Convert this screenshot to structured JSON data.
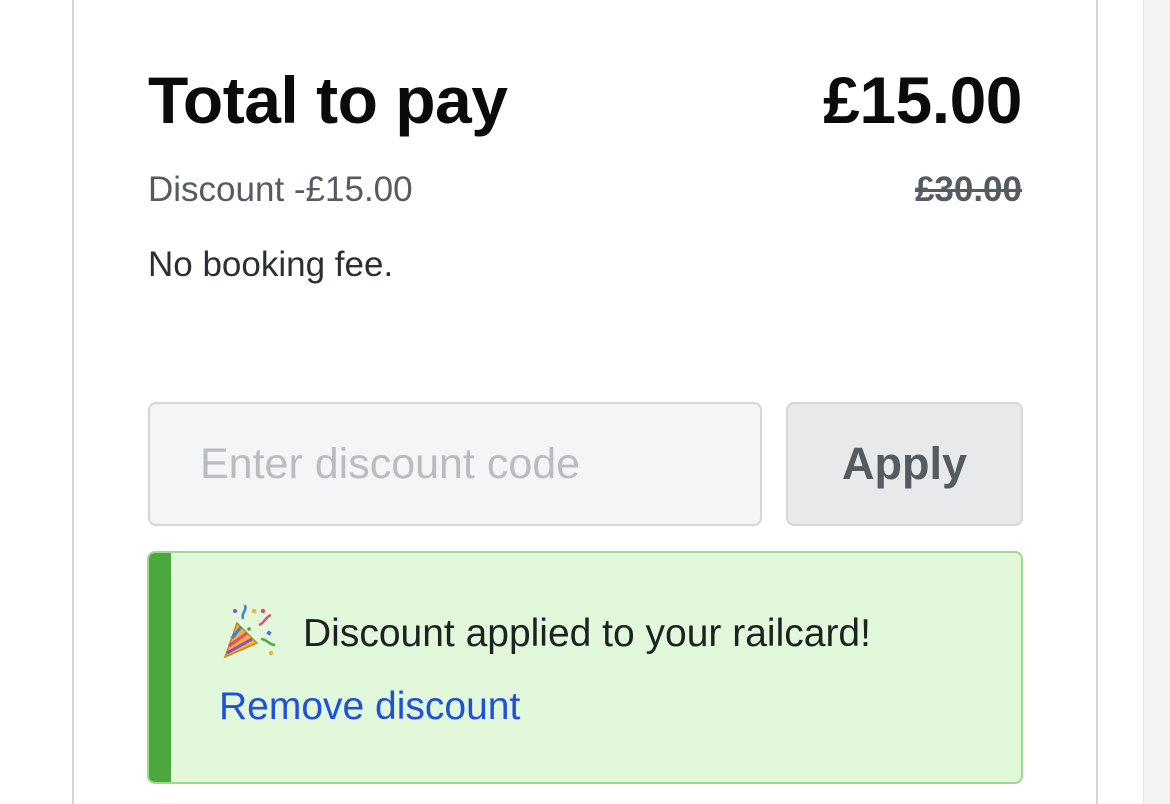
{
  "summary": {
    "total_label": "Total to pay",
    "total_amount": "£15.00",
    "discount_label": "Discount -£15.00",
    "original_price": "£30.00",
    "booking_fee_note": "No booking fee."
  },
  "discount_form": {
    "input_value": "",
    "input_placeholder": "Enter discount code",
    "apply_label": "Apply"
  },
  "alert": {
    "icon": "party-popper-icon",
    "message": "Discount applied to your railcard!",
    "remove_link_label": "Remove discount"
  },
  "colors": {
    "alert_background": "#e2f8da",
    "alert_accent": "#4aa83c",
    "link": "#1f4fe0",
    "text_primary": "#0b0b0b",
    "text_secondary": "#555b61"
  }
}
